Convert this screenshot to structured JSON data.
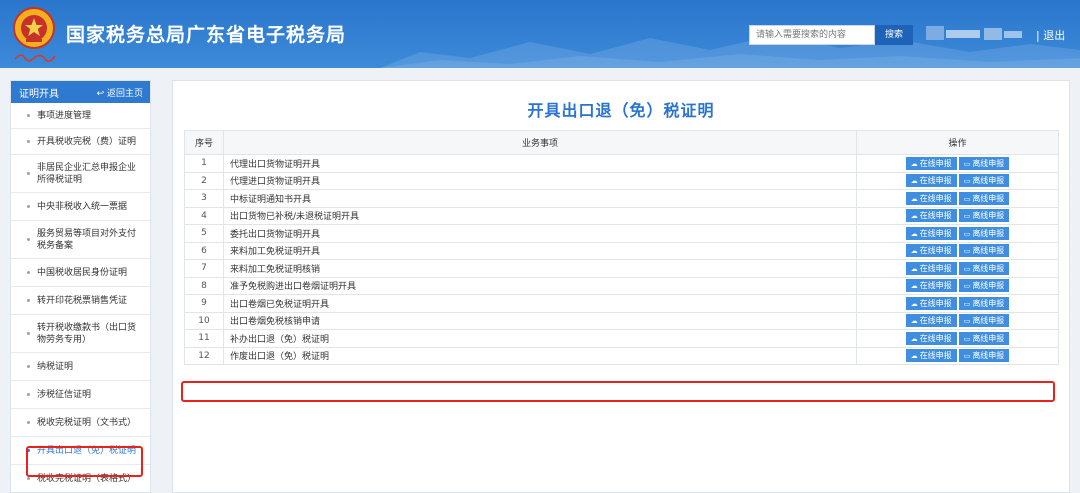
{
  "header": {
    "site_title": "国家税务总局广东省电子税务局",
    "search_placeholder": "请输入需要搜索的内容",
    "search_label": "搜索",
    "logout_label": "| 退出",
    "colors": {
      "header_bg": "#2a76cc",
      "accent": "#2b77d6",
      "highlight": "#e8231c"
    }
  },
  "sidebar": {
    "title": "证明开具",
    "back_label": "返回主页",
    "items": [
      {
        "label": "事项进度管理",
        "active": false
      },
      {
        "label": "开具税收完税（费）证明",
        "active": false
      },
      {
        "label": "非居民企业汇总申报企业所得税证明",
        "active": false
      },
      {
        "label": "中央非税收入统一票据",
        "active": false
      },
      {
        "label": "服务贸易等项目对外支付税务备案",
        "active": false
      },
      {
        "label": "中国税收居民身份证明",
        "active": false
      },
      {
        "label": "转开印花税票销售凭证",
        "active": false
      },
      {
        "label": "转开税收缴款书（出口货物劳务专用）",
        "active": false
      },
      {
        "label": "纳税证明",
        "active": false
      },
      {
        "label": "涉税征信证明",
        "active": false
      },
      {
        "label": "税收完税证明（文书式）",
        "active": false
      },
      {
        "label": "开具出口退（免）税证明",
        "active": true
      },
      {
        "label": "税收完税证明（表格式）",
        "active": false
      }
    ]
  },
  "main": {
    "title": "开具出口退（免）税证明",
    "columns": {
      "no": "序号",
      "item": "业务事项",
      "ops": "操作"
    },
    "online_label": "在线申报",
    "offline_label": "离线申报",
    "rows": [
      {
        "no": "1",
        "name": "代理出口货物证明开具"
      },
      {
        "no": "2",
        "name": "代理进口货物证明开具"
      },
      {
        "no": "3",
        "name": "中标证明通知书开具"
      },
      {
        "no": "4",
        "name": "出口货物已补税/未退税证明开具"
      },
      {
        "no": "5",
        "name": "委托出口货物证明开具"
      },
      {
        "no": "6",
        "name": "来料加工免税证明开具"
      },
      {
        "no": "7",
        "name": "来料加工免税证明核销"
      },
      {
        "no": "8",
        "name": "准予免税购进出口卷烟证明开具"
      },
      {
        "no": "9",
        "name": "出口卷烟已免税证明开具"
      },
      {
        "no": "10",
        "name": "出口卷烟免税核销申请"
      },
      {
        "no": "11",
        "name": "补办出口退（免）税证明"
      },
      {
        "no": "12",
        "name": "作废出口退（免）税证明"
      }
    ]
  }
}
